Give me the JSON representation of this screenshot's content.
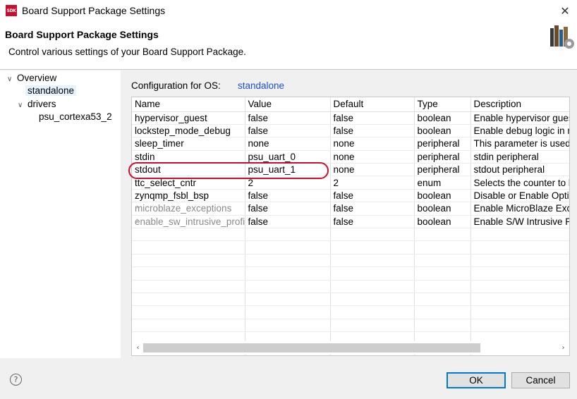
{
  "window": {
    "app_icon_text": "SDK",
    "title": "Board Support Package Settings",
    "close_glyph": "✕"
  },
  "header": {
    "title": "Board Support Package Settings",
    "description": "Control various settings of your Board Support Package."
  },
  "tree": {
    "items": [
      {
        "label": "Overview",
        "arrow": "∨"
      },
      {
        "label": "standalone",
        "selected": true
      },
      {
        "label": "drivers",
        "arrow": "∨"
      },
      {
        "label": "psu_cortexa53_2"
      }
    ]
  },
  "config": {
    "label": "Configuration for OS:",
    "os": "standalone"
  },
  "table": {
    "headers": [
      "Name",
      "Value",
      "Default",
      "Type",
      "Description"
    ],
    "rows": [
      {
        "name": "hypervisor_guest",
        "value": "false",
        "default": "false",
        "type": "boolean",
        "description": "Enable hypervisor guest"
      },
      {
        "name": "lockstep_mode_debug",
        "value": "false",
        "default": "false",
        "type": "boolean",
        "description": "Enable debug logic in n"
      },
      {
        "name": "sleep_timer",
        "value": "none",
        "default": "none",
        "type": "peripheral",
        "description": "This parameter is used t"
      },
      {
        "name": "stdin",
        "value": "psu_uart_0",
        "default": "none",
        "type": "peripheral",
        "description": "stdin peripheral"
      },
      {
        "name": "stdout",
        "value": "psu_uart_1",
        "default": "none",
        "type": "peripheral",
        "description": "stdout peripheral"
      },
      {
        "name": "ttc_select_cntr",
        "value": "2",
        "default": "2",
        "type": "enum",
        "description": "Selects the counter to b"
      },
      {
        "name": "zynqmp_fsbl_bsp",
        "value": "false",
        "default": "false",
        "type": "boolean",
        "description": "Disable or Enable Optim"
      },
      {
        "name": "microblaze_exceptions",
        "value": "false",
        "default": "false",
        "type": "boolean",
        "description": "Enable MicroBlaze Exce"
      },
      {
        "name": "enable_sw_intrusive_profiling",
        "value": "false",
        "default": "false",
        "type": "boolean",
        "description": "Enable S/W Intrusive Pr"
      }
    ],
    "expand_glyph": "›"
  },
  "scroll": {
    "left": "‹",
    "right": "›"
  },
  "footer": {
    "help_glyph": "?",
    "ok_label": "OK",
    "cancel_label": "Cancel"
  },
  "colors": {
    "highlight": "#c8102e",
    "link": "#1a4fd6",
    "selection": "#e5f3ff"
  }
}
